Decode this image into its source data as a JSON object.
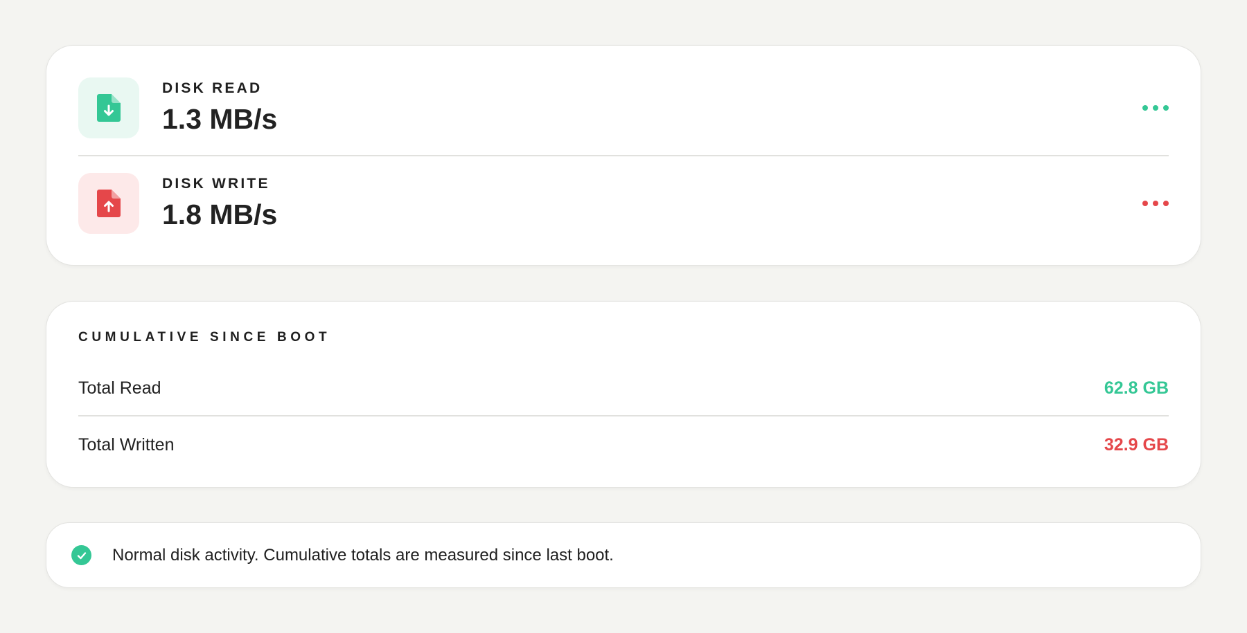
{
  "rates": {
    "read": {
      "label": "DISK READ",
      "value": "1.3 MB/s",
      "icon": "file-download-icon",
      "accent": "#34c795",
      "tile_bg": "#e9f8f2"
    },
    "write": {
      "label": "DISK WRITE",
      "value": "1.8 MB/s",
      "icon": "file-upload-icon",
      "accent": "#e5474a",
      "tile_bg": "#fde9e9"
    }
  },
  "cumulative": {
    "title": "CUMULATIVE SINCE BOOT",
    "total_read": {
      "label": "Total Read",
      "value": "62.8 GB",
      "color": "#34c795"
    },
    "total_written": {
      "label": "Total Written",
      "value": "32.9 GB",
      "color": "#e5474a"
    }
  },
  "status": {
    "icon": "check-circle-icon",
    "text": "Normal disk activity. Cumulative totals are measured since last boot.",
    "color": "#34c795"
  }
}
